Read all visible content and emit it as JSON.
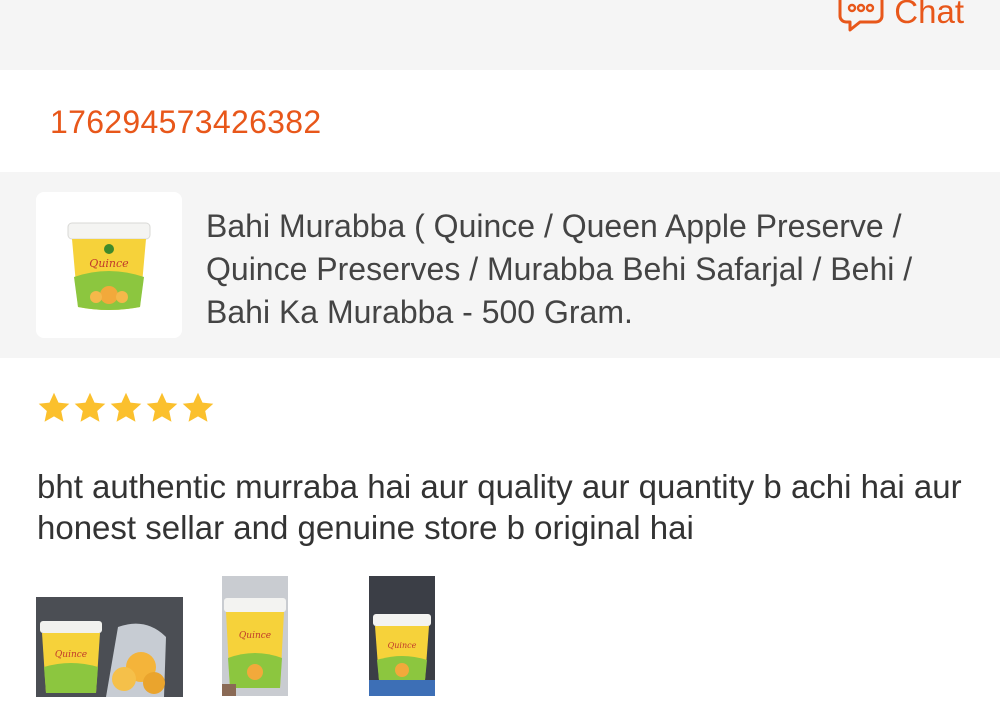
{
  "header": {
    "chat_label": "Chat",
    "chat_icon": "chat-bubble-icon",
    "accent_color": "#e8571a"
  },
  "order": {
    "id": "176294573426382"
  },
  "product": {
    "title": "Bahi Murabba ( Quince / Queen Apple Preserve / Quince Preserves / Murabba Behi Safarjal / Behi / Bahi Ka Murabba  - 500 Gram.",
    "thumbnail_label": "Quince"
  },
  "review": {
    "rating": 5,
    "max_rating": 5,
    "star_color": "#fbc02d",
    "text": "bht authentic murraba hai aur quality aur quantity b achi hai aur honest sellar and genuine store b original hai",
    "photos": [
      {
        "label": "Quince"
      },
      {
        "label": "Quince"
      },
      {
        "label": "Quince"
      }
    ]
  }
}
